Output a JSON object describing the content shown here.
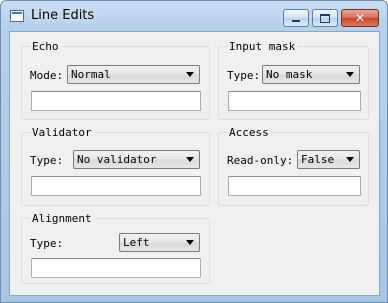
{
  "window": {
    "title": "Line Edits"
  },
  "groups": {
    "echo": {
      "title": "Echo",
      "label": "Mode:",
      "selected": "Normal",
      "text": ""
    },
    "input_mask": {
      "title": "Input mask",
      "label": "Type:",
      "selected": "No mask",
      "text": ""
    },
    "validator": {
      "title": "Validator",
      "label": "Type:",
      "selected": "No validator",
      "text": ""
    },
    "access": {
      "title": "Access",
      "label": "Read-only:",
      "selected": "False",
      "text": ""
    },
    "alignment": {
      "title": "Alignment",
      "label": "Type:",
      "selected": "Left",
      "text": ""
    }
  },
  "icons": {
    "app": "app-window-icon",
    "minimize": "minimize-icon",
    "maximize": "maximize-icon",
    "close": "close-icon"
  }
}
